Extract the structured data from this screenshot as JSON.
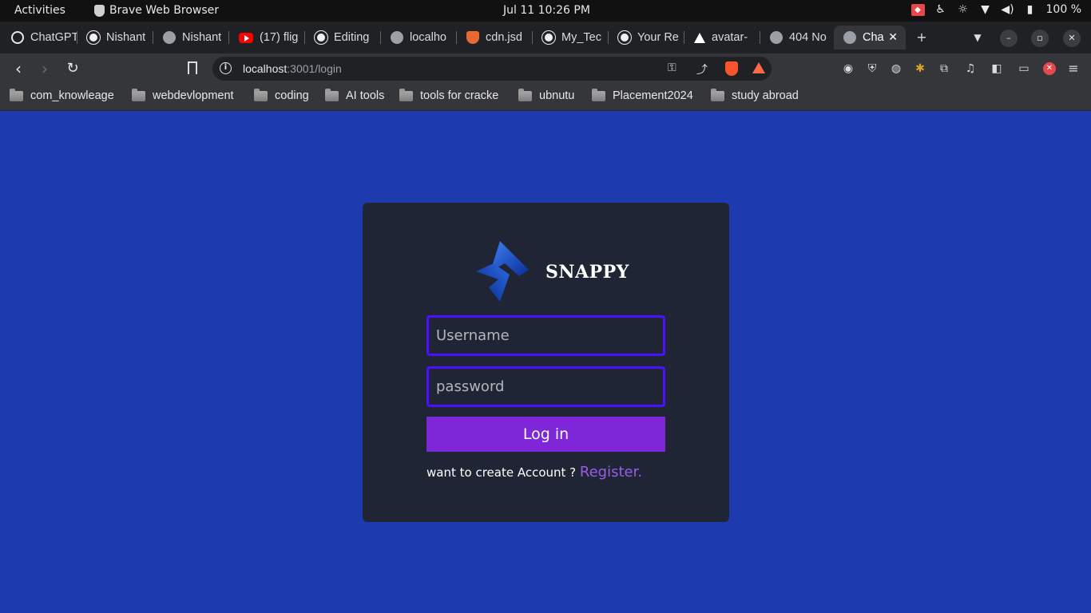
{
  "topbar": {
    "activities": "Activities",
    "app_name": "Brave Web Browser",
    "clock": "Jul 11  10:26 PM",
    "battery": "100 %"
  },
  "tabs": [
    {
      "title": "ChatGPT",
      "icon": "chatgpt-icon"
    },
    {
      "title": "Nishant",
      "icon": "github-icon"
    },
    {
      "title": "Nishant",
      "icon": "globe-icon"
    },
    {
      "title": "(17) flig",
      "icon": "youtube-icon"
    },
    {
      "title": "Editing",
      "icon": "github-icon"
    },
    {
      "title": "localho",
      "icon": "globe-icon"
    },
    {
      "title": "cdn.jsd",
      "icon": "shield-icon"
    },
    {
      "title": "My_Tec",
      "icon": "github-icon"
    },
    {
      "title": "Your Re",
      "icon": "github-icon"
    },
    {
      "title": "avatar-",
      "icon": "triangle-icon"
    },
    {
      "title": "404 No",
      "icon": "globe-icon"
    },
    {
      "title": "Cha",
      "icon": "globe-icon",
      "active": true
    }
  ],
  "address": {
    "host": "localhost",
    "path": ":3001/login"
  },
  "bookmarks": [
    "com_knowleage",
    "webdevlopment",
    "coding",
    "AI tools",
    "tools for cracke",
    "ubnutu",
    "Placement2024",
    "study abroad"
  ],
  "login": {
    "brand": "SNAPPY",
    "username_placeholder": "Username",
    "password_placeholder": "password",
    "login_label": "Log in",
    "register_prompt": "want to create Account ? ",
    "register_link": "Register."
  },
  "colors": {
    "page_background": "#1e3aaf",
    "card_background": "#1f2535",
    "input_border": "#4e0eff",
    "button": "#7d27d8",
    "link": "#9a5ce8"
  }
}
